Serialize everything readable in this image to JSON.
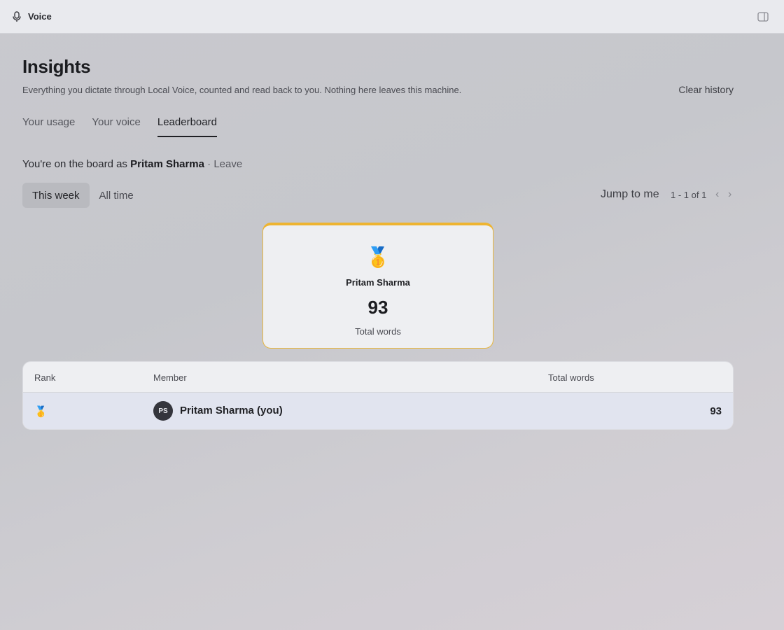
{
  "app": {
    "title": "Voice",
    "icon": "microphone-icon",
    "sidebar_toggle_icon": "sidebar-toggle-icon"
  },
  "header": {
    "title": "Insights",
    "subtitle": "Everything you dictate through Local Voice, counted and read back to you. Nothing here leaves this machine.",
    "clear_history": "Clear history"
  },
  "tabs": [
    {
      "label": "Your usage",
      "active": false
    },
    {
      "label": "Your voice",
      "active": false
    },
    {
      "label": "Leaderboard",
      "active": true
    }
  ],
  "board": {
    "prefix": "You're on the board as",
    "name": "Pritam Sharma",
    "separator": "·",
    "leave": "Leave"
  },
  "filter": {
    "options": [
      {
        "label": "This week",
        "active": true
      },
      {
        "label": "All time",
        "active": false
      }
    ]
  },
  "pagination": {
    "jump_to_me": "Jump to me",
    "range": "1 - 1 of 1",
    "prev": "‹",
    "next": "›"
  },
  "podium": {
    "medal": "🥇",
    "name": "Pritam Sharma",
    "value": "93",
    "label": "Total words",
    "accent_color": "#eeb430"
  },
  "table": {
    "columns": [
      "Rank",
      "Member",
      "Total words"
    ],
    "rows": [
      {
        "rank": "🥇",
        "initials": "PS",
        "member": "Pritam Sharma (you)",
        "total_words": "93"
      }
    ]
  }
}
